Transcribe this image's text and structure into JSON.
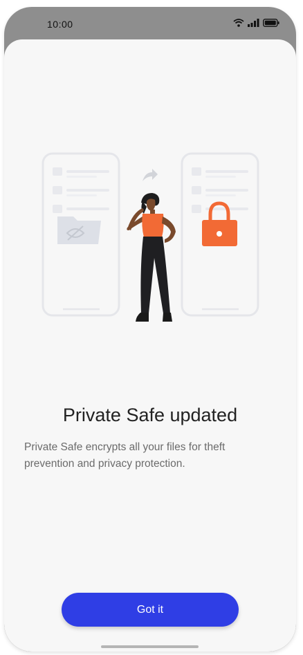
{
  "status_bar": {
    "time": "10:00",
    "icons": [
      "wifi-icon",
      "signal-icon",
      "battery-icon"
    ]
  },
  "illustration": {
    "left_phone_icon": "folder-hidden-icon",
    "arrow_icon": "forward-arrow-icon",
    "right_phone_icon": "lock-icon",
    "figure": "person-illustration",
    "accent_color": "#f26a35"
  },
  "dialog": {
    "title": "Private Safe updated",
    "description": "Private Safe encrypts all your files for theft prevention and privacy protection.",
    "button_label": "Got it",
    "button_color": "#2f3ee5"
  }
}
